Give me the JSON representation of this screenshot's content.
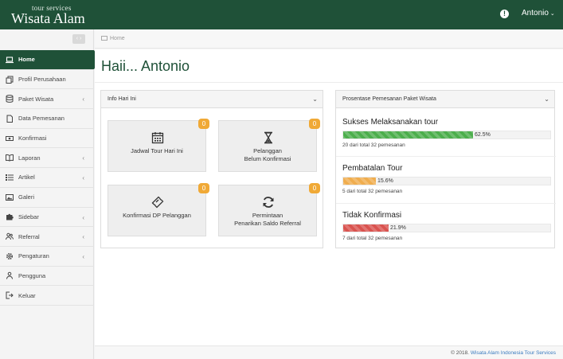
{
  "brand": {
    "subtitle": "tour services",
    "title": "Wisata Alam"
  },
  "header": {
    "alert_icon": "exclamation-circle-icon",
    "user_name": "Antonio",
    "user_caret": "⌄"
  },
  "sidebar": {
    "collapse_glyph": "‹ ›",
    "items": [
      {
        "label": "Home",
        "icon": "laptop-icon",
        "active": true,
        "has_submenu": false
      },
      {
        "label": "Profil Perusahaan",
        "icon": "copy-icon",
        "has_submenu": false
      },
      {
        "label": "Paket Wisata",
        "icon": "database-icon",
        "has_submenu": true
      },
      {
        "label": "Data Pemesanan",
        "icon": "file-icon",
        "has_submenu": false
      },
      {
        "label": "Konfirmasi",
        "icon": "money-icon",
        "has_submenu": false
      },
      {
        "label": "Laporan",
        "icon": "book-icon",
        "has_submenu": true
      },
      {
        "label": "Artikel",
        "icon": "list-icon",
        "has_submenu": true
      },
      {
        "label": "Galeri",
        "icon": "image-icon",
        "has_submenu": false
      },
      {
        "label": "Sidebar",
        "icon": "puzzle-icon",
        "has_submenu": true
      },
      {
        "label": "Referral",
        "icon": "users-icon",
        "has_submenu": true
      },
      {
        "label": "Pengaturan",
        "icon": "gear-icon",
        "has_submenu": true
      },
      {
        "label": "Pengguna",
        "icon": "user-group-icon",
        "has_submenu": false
      },
      {
        "label": "Keluar",
        "icon": "sign-out-icon",
        "has_submenu": false
      }
    ]
  },
  "breadcrumb": {
    "label": "Home"
  },
  "page": {
    "title": "Haii... Antonio"
  },
  "info_panel": {
    "title": "Info Hari Ini",
    "tiles": [
      {
        "label_1": "Jadwal Tour Hari Ini",
        "label_2": "",
        "badge": "0",
        "icon": "calendar-icon"
      },
      {
        "label_1": "Pelanggan",
        "label_2": "Belum Konfirmasi",
        "badge": "0",
        "icon": "hourglass-icon"
      },
      {
        "label_1": "Konfirmasi DP Pelanggan",
        "label_2": "",
        "badge": "0",
        "icon": "ticket-icon"
      },
      {
        "label_1": "Permintaan",
        "label_2": "Penarikan Saldo Referral",
        "badge": "0",
        "icon": "refresh-icon"
      }
    ]
  },
  "stats_panel": {
    "title": "Prosentase Pemesanan Paket Wisata",
    "stats": [
      {
        "title": "Sukses Melaksanakan tour",
        "percent_label": "62.5%",
        "fraction": 0.625,
        "color": "#4cae4c",
        "sub": "20 dari total 32 pemesanan"
      },
      {
        "title": "Pembatalan Tour",
        "percent_label": "15.6%",
        "fraction": 0.156,
        "color": "#f0ad4e",
        "sub": "5 dari total 32 pemesanan"
      },
      {
        "title": "Tidak Konfirmasi",
        "percent_label": "21.9%",
        "fraction": 0.219,
        "color": "#d9534f",
        "sub": "7 dari total 32 pemesanan"
      }
    ]
  },
  "footer": {
    "copyright": "© 2018.",
    "link": "Wisata Alam Indonesia Tour Services"
  },
  "colors": {
    "primary": "#1f5138",
    "badge": "#f0a936",
    "link": "#3a7bbf"
  }
}
